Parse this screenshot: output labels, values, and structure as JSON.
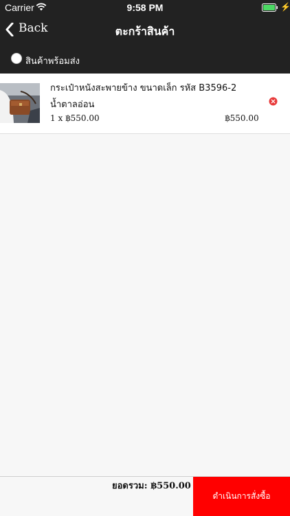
{
  "status_bar": {
    "carrier": "Carrier",
    "time": "9:58 PM",
    "wifi_icon": "wifi-icon",
    "battery_icon": "battery-full-icon",
    "charging_icon": "charging-bolt-icon"
  },
  "nav": {
    "back_label": "Back",
    "back_icon": "chevron-left-icon",
    "title": "ตะกร้าสินค้า"
  },
  "shipping_option": {
    "label": "สินค้าพร้อมส่ง"
  },
  "cart": {
    "items": [
      {
        "name": "กระเป๋าหนังสะพายข้าง ขนาดเล็ก รหัส B3596-2 น้ำตาลอ่อน",
        "quantity_price": "1 x ฿550.00",
        "line_total": "฿550.00",
        "remove_icon": "remove-circle-icon"
      }
    ]
  },
  "footer": {
    "total_label": "ยอดรวม: ฿550.00",
    "checkout_label": "ดำเนินการสั่งซื้อ"
  },
  "colors": {
    "bar_background": "#222222",
    "checkout_button": "#ff0000",
    "remove_icon": "#e83a3a",
    "page_background": "#f7f7f7"
  }
}
